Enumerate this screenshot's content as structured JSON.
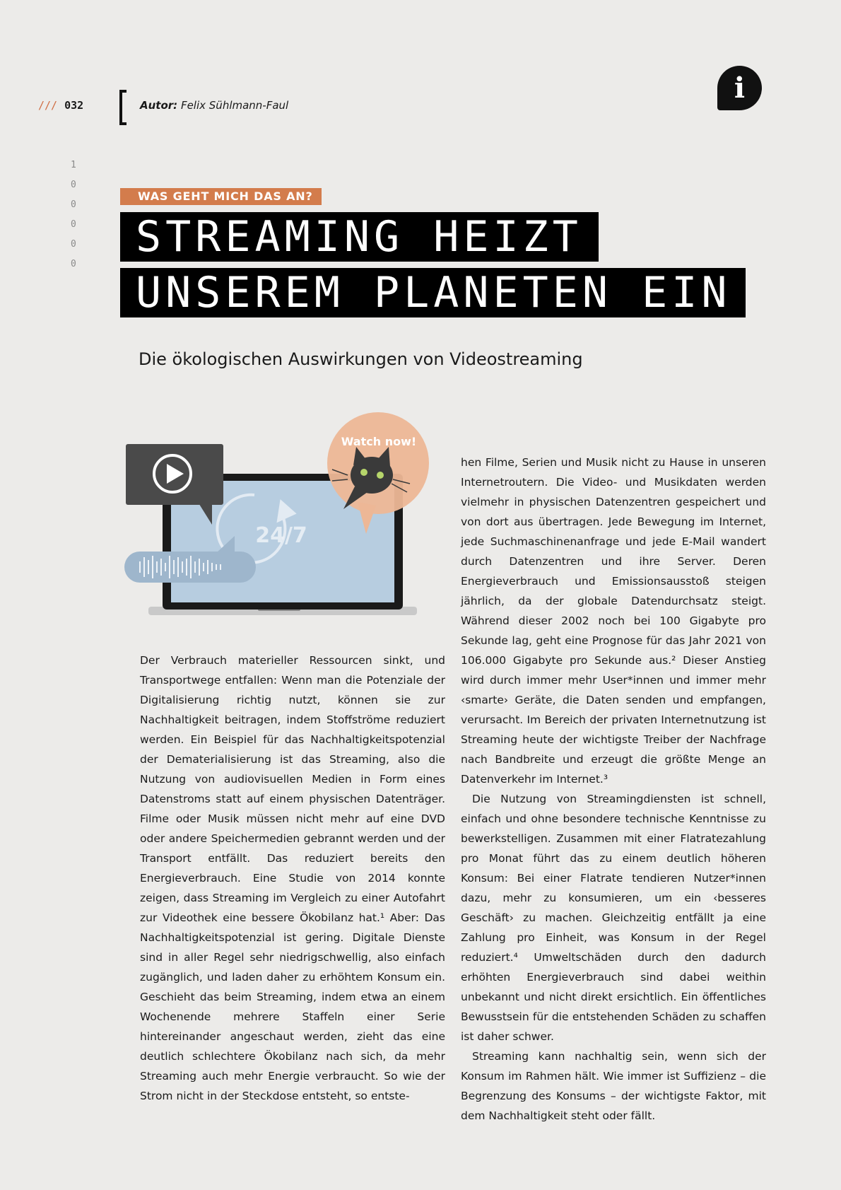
{
  "header": {
    "slashes": "///",
    "page_number": "032",
    "author_label": "Autor:",
    "author_name": "Felix Sühlmann-Faul",
    "info_icon": "info-icon"
  },
  "binary_digits": [
    "1",
    "0",
    "0",
    "0",
    "0",
    "0"
  ],
  "kicker": "WAS GEHT MICH DAS AN?",
  "title": {
    "line1": "STREAMING HEIZT",
    "line2": "UNSEREM PLANETEN EIN"
  },
  "subtitle": "Die ökologischen Auswirkungen von Videostreaming",
  "illustration": {
    "bubble_text": "Watch now!",
    "screen_text": "24/7"
  },
  "body": {
    "left_paragraphs": [
      "Der Verbrauch materieller Ressourcen sinkt, und Transportwege entfallen: Wenn man die Potenziale der Digitalisierung richtig nutzt, können sie zur Nachhaltigkeit beitragen, indem Stoffströme reduziert werden. Ein Beispiel für das Nachhaltigkeitspotenzial der Dematerialisierung ist das Streaming, also die Nutzung von audiovisuellen Medien in Form eines Datenstroms statt auf einem physischen Datenträger. Filme oder Musik müssen nicht mehr auf eine DVD oder andere Speichermedien gebrannt werden und der Transport entfällt. Das reduziert bereits den Energieverbrauch. Eine Studie von 2014 konnte zeigen, dass Streaming im Vergleich zu einer Autofahrt zur Videothek eine bessere Ökobilanz hat.¹ Aber: Das Nachhaltigkeitspotenzial ist gering. Digitale Dienste sind in aller Regel sehr niedrigschwellig, also einfach zugänglich, und laden daher zu erhöhtem Konsum ein. Geschieht das beim Streaming, indem etwa an einem Wochenende mehrere Staffeln einer Serie hintereinander angeschaut werden, zieht das eine deutlich schlechtere Ökobilanz nach sich, da mehr Streaming auch mehr Energie verbraucht. So wie der Strom nicht in der Steckdose entsteht, so entste-"
    ],
    "right_paragraphs": [
      "hen Filme, Serien und Musik nicht zu Hause in unseren Internetroutern. Die Video- und Musikdaten werden vielmehr in physischen Datenzentren gespeichert und von dort aus übertragen. Jede Bewegung im Internet, jede Suchmaschinenanfrage und jede E-Mail wandert durch Datenzentren und ihre Server. Deren Energieverbrauch und Emissionsausstoß steigen jährlich, da der globale Datendurchsatz steigt. Während dieser 2002 noch bei 100 Gigabyte pro Sekunde lag, geht eine Prognose für das Jahr 2021 von 106.000 Gigabyte pro Sekunde aus.² Dieser Anstieg wird durch immer mehr User*innen und immer mehr ‹smarte› Geräte, die Daten senden und empfangen, verursacht. Im Bereich der privaten Internetnutzung ist Streaming heute der wichtigste Treiber der Nachfrage nach Bandbreite und erzeugt die größte Menge an Datenverkehr im Internet.³",
      "Die Nutzung von Streamingdiensten ist schnell, einfach und ohne besondere technische Kenntnisse zu bewerkstelligen. Zusammen mit einer Flatratezahlung pro Monat führt das zu einem deutlich höheren Konsum: Bei einer Flatrate tendieren Nutzer*innen dazu, mehr zu konsumieren, um ein ‹besseres Geschäft› zu machen. Gleichzeitig entfällt ja eine Zahlung pro Einheit, was Konsum in der Regel reduziert.⁴ Umweltschäden durch den dadurch erhöhten Energieverbrauch sind dabei weithin unbekannt und nicht direkt ersichtlich. Ein öffentliches Bewusstsein für die entstehenden Schäden zu schaffen ist daher schwer.",
      "Streaming kann nachhaltig sein, wenn sich der Konsum im Rahmen hält. Wie immer ist Suffizienz – die Begrenzung des Konsums – der wichtigste Faktor, mit dem Nachhaltigkeit steht oder fällt."
    ]
  }
}
